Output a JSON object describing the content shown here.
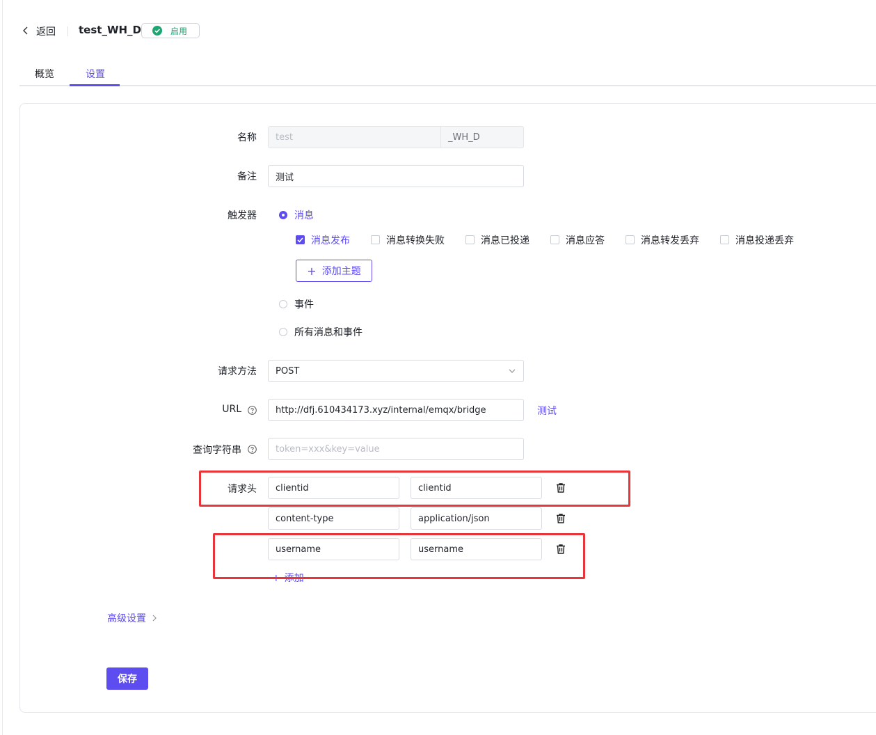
{
  "header": {
    "back_label": "返回",
    "title": "test_WH_D",
    "status": "启用",
    "status_color": "#1ba672"
  },
  "tabs": [
    {
      "label": "概览",
      "active": false
    },
    {
      "label": "设置",
      "active": true
    }
  ],
  "accent_color": "#5d4cf0",
  "form": {
    "name": {
      "label": "名称",
      "prefix": "test",
      "suffix": "_WH_D"
    },
    "note": {
      "label": "备注",
      "value": "测试"
    },
    "trigger": {
      "label": "触发器",
      "options": [
        {
          "label": "消息",
          "selected": true
        },
        {
          "label": "事件",
          "selected": false
        },
        {
          "label": "所有消息和事件",
          "selected": false
        }
      ],
      "message_types": [
        {
          "label": "消息发布",
          "checked": true
        },
        {
          "label": "消息转换失败",
          "checked": false
        },
        {
          "label": "消息已投递",
          "checked": false
        },
        {
          "label": "消息应答",
          "checked": false
        },
        {
          "label": "消息转发丢弃",
          "checked": false
        },
        {
          "label": "消息投递丢弃",
          "checked": false
        }
      ],
      "add_topic_label": "添加主题"
    },
    "method": {
      "label": "请求方法",
      "value": "POST"
    },
    "url": {
      "label": "URL",
      "value": "http://dfj.610434173.xyz/internal/emqx/bridge",
      "test_label": "测试"
    },
    "query": {
      "label": "查询字符串",
      "placeholder": "token=xxx&key=value"
    },
    "headers": {
      "label": "请求头",
      "rows": [
        {
          "key": "clientid",
          "value": "clientid"
        },
        {
          "key": "content-type",
          "value": "application/json"
        },
        {
          "key": "username",
          "value": "username"
        }
      ],
      "add_label": "添加"
    }
  },
  "advanced_label": "高级设置",
  "save_label": "保存"
}
